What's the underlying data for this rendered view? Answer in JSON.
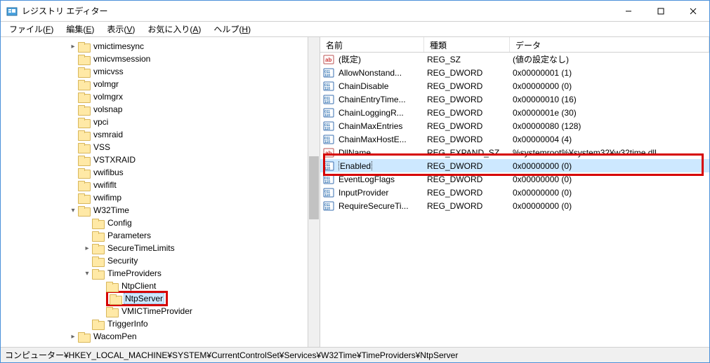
{
  "window": {
    "title": "レジストリ エディター"
  },
  "menu": {
    "file": "ファイル(",
    "file_u": "F",
    "file2": ")",
    "edit": "編集(",
    "edit_u": "E",
    "edit2": ")",
    "view": "表示(",
    "view_u": "V",
    "view2": ")",
    "fav": "お気に入り(",
    "fav_u": "A",
    "fav2": ")",
    "help": "ヘルプ(",
    "help_u": "H",
    "help2": ")"
  },
  "tree": {
    "items": [
      {
        "indent": 96,
        "tw": ">",
        "label": "vmictimesync"
      },
      {
        "indent": 96,
        "tw": "",
        "label": "vmicvmsession"
      },
      {
        "indent": 96,
        "tw": "",
        "label": "vmicvss"
      },
      {
        "indent": 96,
        "tw": "",
        "label": "volmgr"
      },
      {
        "indent": 96,
        "tw": "",
        "label": "volmgrx"
      },
      {
        "indent": 96,
        "tw": "",
        "label": "volsnap"
      },
      {
        "indent": 96,
        "tw": "",
        "label": "vpci"
      },
      {
        "indent": 96,
        "tw": "",
        "label": "vsmraid"
      },
      {
        "indent": 96,
        "tw": "",
        "label": "VSS"
      },
      {
        "indent": 96,
        "tw": "",
        "label": "VSTXRAID"
      },
      {
        "indent": 96,
        "tw": "",
        "label": "vwifibus"
      },
      {
        "indent": 96,
        "tw": "",
        "label": "vwififlt"
      },
      {
        "indent": 96,
        "tw": "",
        "label": "vwifimp"
      },
      {
        "indent": 96,
        "tw": "v",
        "label": "W32Time"
      },
      {
        "indent": 116,
        "tw": "",
        "label": "Config"
      },
      {
        "indent": 116,
        "tw": "",
        "label": "Parameters"
      },
      {
        "indent": 116,
        "tw": ">",
        "label": "SecureTimeLimits"
      },
      {
        "indent": 116,
        "tw": "",
        "label": "Security"
      },
      {
        "indent": 116,
        "tw": "v",
        "label": "TimeProviders"
      },
      {
        "indent": 136,
        "tw": "",
        "label": "NtpClient"
      },
      {
        "indent": 136,
        "tw": "",
        "label": "NtpServer",
        "selected": true,
        "highlight": true
      },
      {
        "indent": 136,
        "tw": "",
        "label": "VMICTimeProvider"
      },
      {
        "indent": 116,
        "tw": "",
        "label": "TriggerInfo"
      },
      {
        "indent": 96,
        "tw": ">",
        "label": "WacomPen"
      }
    ]
  },
  "list": {
    "headers": {
      "name": "名前",
      "type": "種類",
      "data": "データ"
    },
    "rows": [
      {
        "icon": "sz",
        "name": "(既定)",
        "type": "REG_SZ",
        "data": "(値の設定なし)"
      },
      {
        "icon": "dw",
        "name": "AllowNonstand...",
        "type": "REG_DWORD",
        "data": "0x00000001 (1)"
      },
      {
        "icon": "dw",
        "name": "ChainDisable",
        "type": "REG_DWORD",
        "data": "0x00000000 (0)"
      },
      {
        "icon": "dw",
        "name": "ChainEntryTime...",
        "type": "REG_DWORD",
        "data": "0x00000010 (16)"
      },
      {
        "icon": "dw",
        "name": "ChainLoggingR...",
        "type": "REG_DWORD",
        "data": "0x0000001e (30)"
      },
      {
        "icon": "dw",
        "name": "ChainMaxEntries",
        "type": "REG_DWORD",
        "data": "0x00000080 (128)"
      },
      {
        "icon": "dw",
        "name": "ChainMaxHostE...",
        "type": "REG_DWORD",
        "data": "0x00000004 (4)"
      },
      {
        "icon": "sz",
        "name": "DllName",
        "type": "REG_EXPAND_SZ",
        "data": "%systemroot%¥system32¥w32time.dll"
      },
      {
        "icon": "dw",
        "name": "Enabled",
        "type": "REG_DWORD",
        "data": "0x00000000 (0)",
        "selected": true
      },
      {
        "icon": "dw",
        "name": "EventLogFlags",
        "type": "REG_DWORD",
        "data": "0x00000000 (0)"
      },
      {
        "icon": "dw",
        "name": "InputProvider",
        "type": "REG_DWORD",
        "data": "0x00000000 (0)"
      },
      {
        "icon": "dw",
        "name": "RequireSecureTi...",
        "type": "REG_DWORD",
        "data": "0x00000000 (0)"
      }
    ]
  },
  "status": {
    "path": "コンピューター¥HKEY_LOCAL_MACHINE¥SYSTEM¥CurrentControlSet¥Services¥W32Time¥TimeProviders¥NtpServer"
  }
}
